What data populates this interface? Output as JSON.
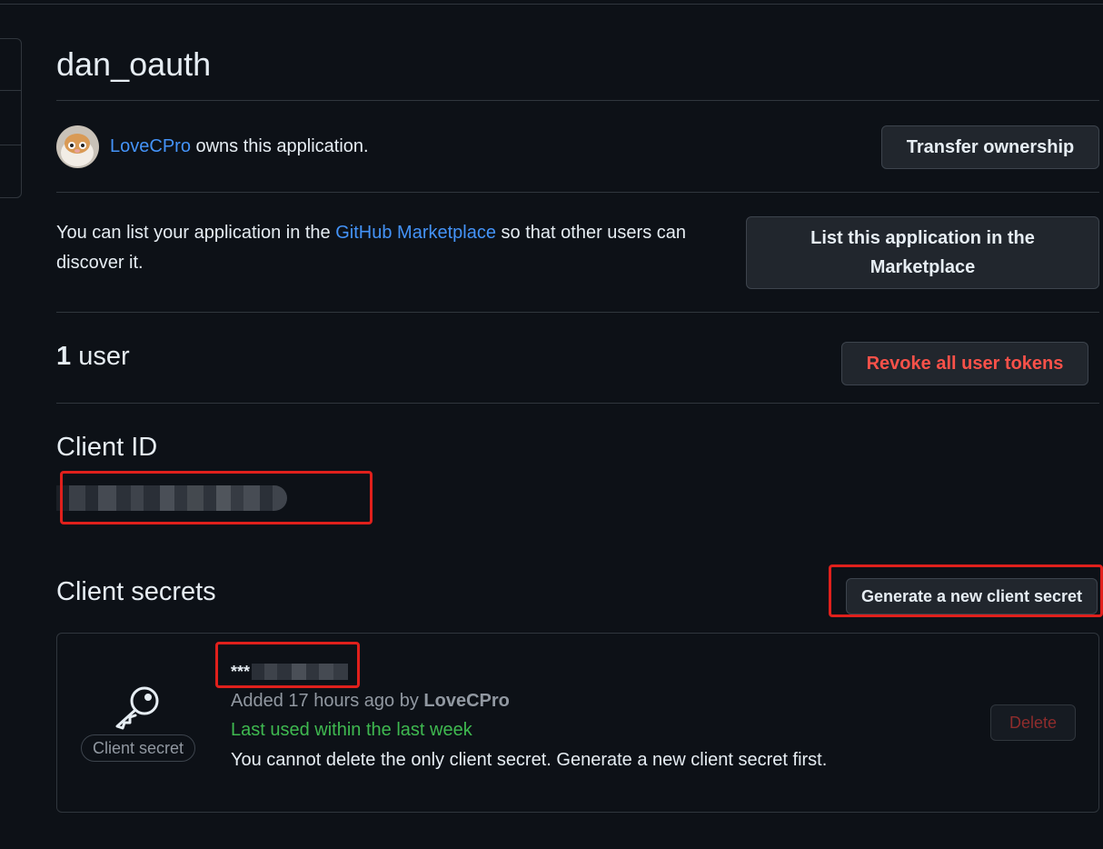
{
  "app": {
    "title": "dan_oauth",
    "owner": {
      "name": "LoveCPro",
      "text": " owns this application.",
      "transfer_label": "Transfer ownership"
    },
    "marketplace": {
      "text_before": "You can list your application in the ",
      "link_label": "GitHub Marketplace",
      "text_after": " so that other users can discover it.",
      "button_label": "List this application in the Marketplace"
    },
    "users": {
      "count": "1",
      "label": " user",
      "revoke_label": "Revoke all user tokens"
    },
    "client_id": {
      "heading": "Client ID"
    },
    "client_secrets": {
      "heading": "Client secrets",
      "generate_label": "Generate a new client secret",
      "secret": {
        "masked_prefix": "***",
        "badge": "Client secret",
        "added_text": "Added 17 hours ago by ",
        "added_by": "LoveCPro",
        "last_used": "Last used within the last week",
        "note": "You cannot delete the only client secret. Generate a new client secret first.",
        "delete_label": "Delete"
      }
    }
  },
  "colors": {
    "background": "#0d1117",
    "link": "#4493f8",
    "danger": "#f85149",
    "success": "#3fb950",
    "annotation": "#e0201c"
  }
}
